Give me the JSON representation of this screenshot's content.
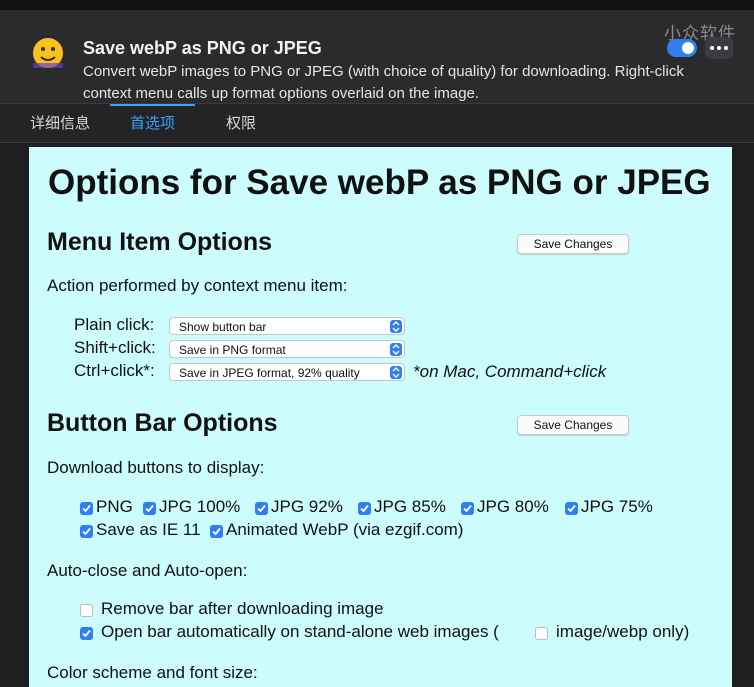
{
  "extension": {
    "title": "Save webP as PNG or JPEG",
    "description": "Convert webP images to PNG or JPEG (with choice of quality) for downloading. Right-click context menu calls up format options overlaid on the image.",
    "enabled": true,
    "watermark": "小众软件"
  },
  "tabs": [
    {
      "label": "详细信息",
      "active": false
    },
    {
      "label": "首选项",
      "active": true
    },
    {
      "label": "权限",
      "active": false
    }
  ],
  "page": {
    "title": "Options for Save webP as PNG or JPEG",
    "menu_section": {
      "heading": "Menu Item Options",
      "save_label": "Save Changes",
      "intro": "Action performed by context menu item:",
      "rows": [
        {
          "label": "Plain click:",
          "value": "Show button bar"
        },
        {
          "label": "Shift+click:",
          "value": "Save in PNG format"
        },
        {
          "label": "Ctrl+click*:",
          "value": "Save in JPEG format, 92% quality"
        }
      ],
      "note": "*on Mac, Command+click"
    },
    "button_section": {
      "heading": "Button Bar Options",
      "save_label": "Save Changes",
      "intro": "Download buttons to display:",
      "buttons_row1": [
        "PNG",
        "JPG 100%",
        "JPG 92%",
        "JPG 85%",
        "JPG 80%",
        "JPG 75%"
      ],
      "buttons_row2": [
        "Save as IE 11",
        "Animated WebP (via ezgif.com)"
      ],
      "auto_heading": "Auto-close and Auto-open:",
      "remove_bar": {
        "label": "Remove bar after downloading image",
        "checked": false
      },
      "open_bar": {
        "label": "Open bar automatically on stand-alone web images (",
        "checked": true
      },
      "webp_only": {
        "label": "image/webp only)",
        "checked": false
      },
      "color_heading": "Color scheme and font size:"
    }
  },
  "colors": {
    "accent": "#2f7ff2",
    "options_bg": "#ccfcfc",
    "panel_bg": "#2b2b2e"
  },
  "icons": {
    "app": "smiley-emoji-icon",
    "more": "ellipsis-icon",
    "check": "checkmark-icon",
    "select": "updown-chevron-icon"
  }
}
